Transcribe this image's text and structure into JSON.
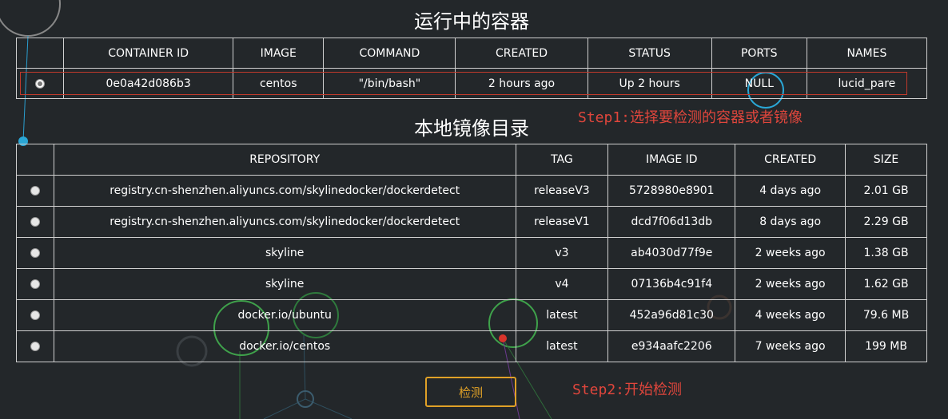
{
  "colors": {
    "background": "#23272a",
    "table_border": "#d0d0d0",
    "highlight_red": "#c0392b",
    "step_text": "#e0463c",
    "button_accent": "#e0a127"
  },
  "containers_section": {
    "title": "运行中的容器",
    "columns": [
      "CONTAINER ID",
      "IMAGE",
      "COMMAND",
      "CREATED",
      "STATUS",
      "PORTS",
      "NAMES"
    ],
    "rows": [
      {
        "id": "0e0a42d086b3",
        "image": "centos",
        "command": "\"/bin/bash\"",
        "created": "2 hours ago",
        "status": "Up 2 hours",
        "ports": "NULL",
        "names": "lucid_pare",
        "selected": true
      }
    ]
  },
  "images_section": {
    "title": "本地镜像目录",
    "columns": [
      "REPOSITORY",
      "TAG",
      "IMAGE ID",
      "CREATED",
      "SIZE"
    ],
    "rows": [
      {
        "repository": "registry.cn-shenzhen.aliyuncs.com/skylinedocker/dockerdetect",
        "tag": "releaseV3",
        "image_id": "5728980e8901",
        "created": "4 days ago",
        "size": "2.01 GB"
      },
      {
        "repository": "registry.cn-shenzhen.aliyuncs.com/skylinedocker/dockerdetect",
        "tag": "releaseV1",
        "image_id": "dcd7f06d13db",
        "created": "8 days ago",
        "size": "2.29 GB"
      },
      {
        "repository": "skyline",
        "tag": "v3",
        "image_id": "ab4030d77f9e",
        "created": "2 weeks ago",
        "size": "1.38 GB"
      },
      {
        "repository": "skyline",
        "tag": "v4",
        "image_id": "07136b4c91f4",
        "created": "2 weeks ago",
        "size": "1.62 GB"
      },
      {
        "repository": "docker.io/ubuntu",
        "tag": "latest",
        "image_id": "452a96d81c30",
        "created": "4 weeks ago",
        "size": "79.6 MB"
      },
      {
        "repository": "docker.io/centos",
        "tag": "latest",
        "image_id": "e934aafc2206",
        "created": "7 weeks ago",
        "size": "199 MB"
      }
    ]
  },
  "annotations": {
    "step1": "Step1:选择要检测的容器或者镜像",
    "step2": "Step2:开始检测"
  },
  "detect_button": {
    "label": "检测"
  }
}
